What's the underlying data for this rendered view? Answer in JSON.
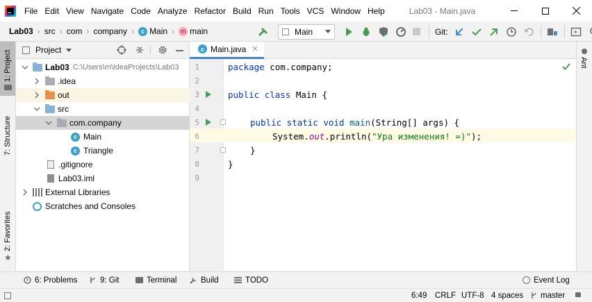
{
  "menu": {
    "items": [
      {
        "label": "File",
        "key": "F"
      },
      {
        "label": "Edit",
        "key": "E"
      },
      {
        "label": "View",
        "key": "V"
      },
      {
        "label": "Navigate",
        "key": "N"
      },
      {
        "label": "Code",
        "key": "C"
      },
      {
        "label": "Analyze",
        "key": "z"
      },
      {
        "label": "Refactor",
        "key": "R"
      },
      {
        "label": "Build",
        "key": "B"
      },
      {
        "label": "Run",
        "key": "u"
      },
      {
        "label": "Tools",
        "key": "T"
      },
      {
        "label": "VCS",
        "key": "S"
      },
      {
        "label": "Window",
        "key": "W"
      },
      {
        "label": "Help",
        "key": "H"
      }
    ],
    "window_title": "Lab03 - Main.java"
  },
  "breadcrumb": {
    "project": "Lab03",
    "src": "src",
    "com": "com",
    "company": "company",
    "cls": "Main",
    "method": "main"
  },
  "toolbar": {
    "run_config": "Main",
    "git_label": "Git:"
  },
  "project_panel": {
    "title": "Project",
    "tree": [
      {
        "label": "Lab03",
        "path": "C:\\Users\\m\\IdeaProjects\\Lab03"
      },
      {
        "label": ".idea"
      },
      {
        "label": "out"
      },
      {
        "label": "src"
      },
      {
        "label": "com.company"
      },
      {
        "label": "Main"
      },
      {
        "label": "Triangle"
      },
      {
        "label": ".gitignore"
      },
      {
        "label": "Lab03.iml"
      },
      {
        "label": "External Libraries"
      },
      {
        "label": "Scratches and Consoles"
      }
    ]
  },
  "left_tabs": {
    "project": "1: Project",
    "structure": "7: Structure",
    "favorites": "2: Favorites"
  },
  "right_tabs": {
    "ant": "Ant"
  },
  "editor": {
    "tab": "Main.java",
    "lines": [
      "1",
      "2",
      "3",
      "4",
      "5",
      "6",
      "7",
      "8",
      "9"
    ],
    "code": {
      "l1_kw": "package",
      "l1_rest": " com.company;",
      "l3_kw1": "public",
      "l3_kw2": "class",
      "l3_rest": " Main {",
      "l5_kw": "public static void",
      "l5_fn": "main",
      "l5_rest": "(String[] args) {",
      "l6_a": "System.",
      "l6_out": "out",
      "l6_b": ".println(",
      "l6_str": "\"Ура изменения! =)\"",
      "l6_c": ");",
      "l7": "}",
      "l8": "}"
    }
  },
  "bottom_tools": {
    "problems": "6: Problems",
    "git": "9: Git",
    "terminal": "Terminal",
    "build": "Build",
    "todo": "TODO",
    "event_log": "Event Log"
  },
  "status": {
    "position": "6:49",
    "line_sep": "CRLF",
    "encoding": "UTF-8",
    "indent": "4 spaces",
    "branch": "master"
  },
  "colors": {
    "accent": "#3aa0c9",
    "run_green": "#499c54",
    "folder_blue": "#87b3d6",
    "folder_orange": "#e2904a",
    "selection": "#d5d5d5",
    "line_highlight": "#fffae3"
  }
}
